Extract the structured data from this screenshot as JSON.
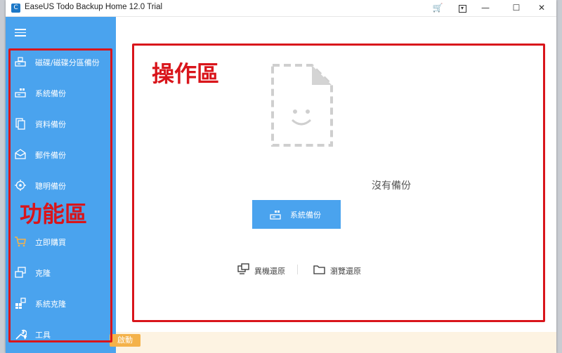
{
  "window": {
    "title": "EaseUS Todo Backup Home 12.0 Trial",
    "logo_glyph": "C"
  },
  "titlebar_buttons": {
    "cart_glyph": "🛒",
    "menu_glyph": "▾",
    "minimize_glyph": "—",
    "maximize_glyph": "☐",
    "close_glyph": "✕"
  },
  "sidebar": {
    "items": [
      {
        "label": "磁碟/磁碟分區備份",
        "icon": "disk-backup-icon"
      },
      {
        "label": "系統備份",
        "icon": "system-backup-icon"
      },
      {
        "label": "資料備份",
        "icon": "file-backup-icon"
      },
      {
        "label": "郵件備份",
        "icon": "mail-backup-icon"
      },
      {
        "label": "聰明備份",
        "icon": "smart-backup-icon"
      },
      {
        "label": "立即購買",
        "icon": "cart-icon"
      },
      {
        "label": "克隆",
        "icon": "clone-icon"
      },
      {
        "label": "系統克隆",
        "icon": "system-clone-icon"
      },
      {
        "label": "工具",
        "icon": "wrench-icon"
      }
    ]
  },
  "main": {
    "empty_text": "沒有備份",
    "primary_button": "系統備份",
    "links": [
      {
        "label": "異機還原",
        "icon": "remote-restore-icon"
      },
      {
        "label": "瀏覽還原",
        "icon": "folder-icon"
      }
    ]
  },
  "annotations": {
    "function_area": "功能區",
    "operation_area": "操作區"
  },
  "footer": {
    "button_label": "啟動"
  },
  "colors": {
    "sidebar": "#4aa3ee",
    "annotation_red": "#d9151b",
    "primary": "#4aa3ee"
  }
}
